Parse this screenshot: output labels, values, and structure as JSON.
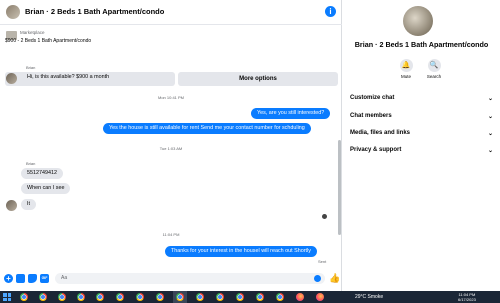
{
  "header": {
    "title": "Brian · 2 Beds 1 Bath Apartment/condo",
    "info_icon": "info-icon"
  },
  "marketplace": {
    "label": "Marketplace",
    "listing": "$900 - 2 Beds 1 Bath Apartment/condo",
    "pending_label": "Mark as pending",
    "more_label": "More options"
  },
  "messages": {
    "sender1": "Brian",
    "m1": "Hi, is this available? $900 a month",
    "ts1": "Mon 10:41 PM",
    "m2": "Yes, are you still interested?",
    "m3": "Yes the house is still available for rent Send me your contact number for schduling",
    "ts2": "Tue 1:03 AM",
    "sender2": "Brian",
    "m4": "5512749412",
    "m5": "When can I see",
    "m6": "It",
    "ts3": "11:04 PM",
    "m7": "Thanks for your interest in the housel will reach out Shortly",
    "status": "Sent"
  },
  "composer": {
    "placceholder_text": "Aa"
  },
  "info": {
    "title": "Brian · 2 Beds 1 Bath Apartment/condo",
    "mute_label": "Mute",
    "search_label": "Search",
    "sections": [
      "Customize chat",
      "Chat members",
      "Media, files and links",
      "Privacy & support"
    ]
  },
  "taskbar": {
    "weather": "29°C  Smoke",
    "time": "11:04 PM",
    "date": "6/17/2023"
  },
  "colors": {
    "accent": "#0a7cff",
    "bubble_in": "#e4e6eb",
    "taskbar": "#1b2636"
  }
}
